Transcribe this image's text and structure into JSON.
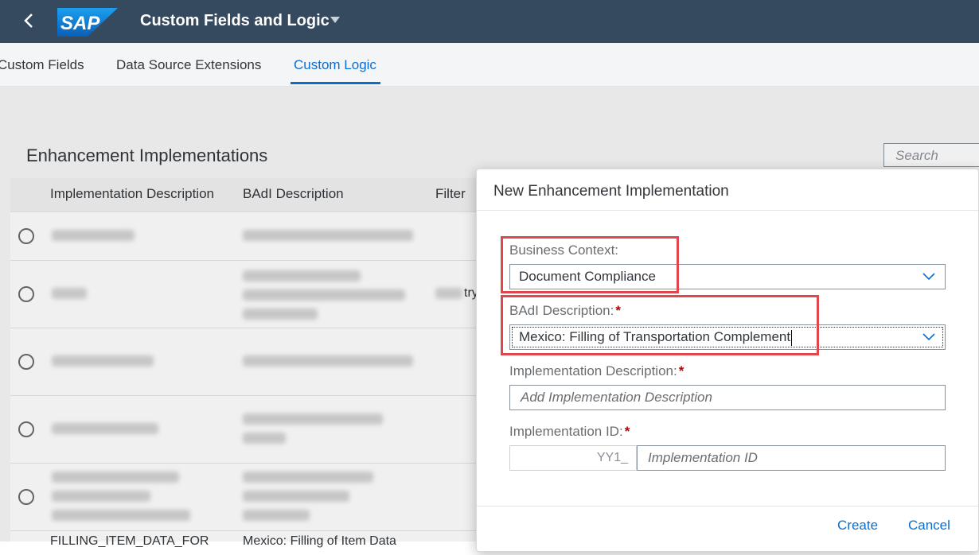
{
  "shell": {
    "app_title": "Custom Fields and Logic",
    "logo_text": "SAP"
  },
  "tabs": [
    {
      "label": "Custom Fields"
    },
    {
      "label": "Data Source Extensions"
    },
    {
      "label": "Custom Logic"
    }
  ],
  "page": {
    "section_title": "Enhancement Implementations",
    "search_placeholder": "Search",
    "table": {
      "columns": [
        "Implementation Description",
        "BAdI Description",
        "Filter"
      ],
      "partial_cell_text": "try",
      "last_row": {
        "col1": "FILLING_ITEM_DATA_FOR",
        "col2": "Mexico: Filling of Item Data"
      }
    }
  },
  "dialog": {
    "title": "New Enhancement Implementation",
    "business_context_label": "Business Context:",
    "business_context_value": "Document Compliance",
    "badi_label": "BAdI Description:",
    "badi_value": "Mexico: Filling of Transportation Complement",
    "impl_desc_label": "Implementation Description:",
    "impl_desc_placeholder": "Add Implementation Description",
    "impl_id_label": "Implementation ID:",
    "impl_id_prefix": "YY1_",
    "impl_id_placeholder": "Implementation ID",
    "required_mark": "*",
    "create_label": "Create",
    "cancel_label": "Cancel"
  },
  "colors": {
    "shell": "#354a5f",
    "accent": "#0a6ed1",
    "highlight": "#e0474c",
    "required": "#bb0000"
  }
}
